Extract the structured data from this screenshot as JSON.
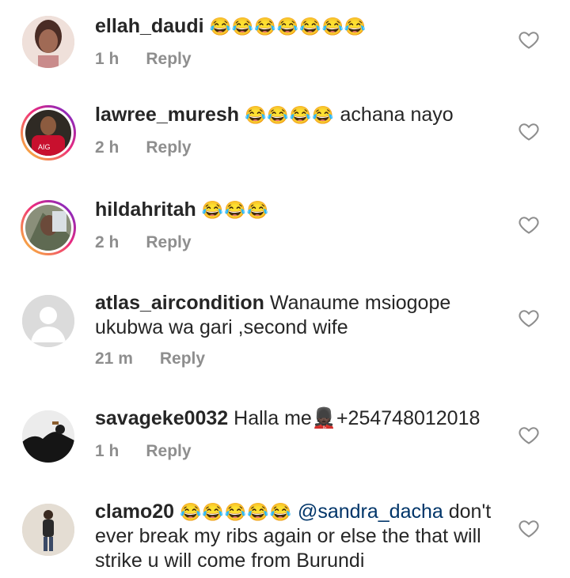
{
  "comments": [
    {
      "username": "ellah_daudi",
      "text": "",
      "emojis": "😂😂😂😂😂😂😂",
      "time": "1 h",
      "reply": "Reply",
      "avatar": "woman-portrait",
      "story_ring": false
    },
    {
      "username": "lawree_muresh",
      "text": "achana nayo",
      "emojis": "😂😂😂😂",
      "time": "2 h",
      "reply": "Reply",
      "avatar": "footballer-red-jersey",
      "avatar_caption": "AIG",
      "story_ring": true
    },
    {
      "username": "hildahritah",
      "text": "",
      "emojis": "😂😂😂",
      "time": "2 h",
      "reply": "Reply",
      "avatar": "selfie",
      "story_ring": true
    },
    {
      "username": "atlas_aircondition",
      "text": "Wanaume msiogope ukubwa wa gari ,second wife",
      "emojis": "",
      "time": "21 m",
      "reply": "Reply",
      "avatar": "default-avatar",
      "story_ring": false
    },
    {
      "username": "savageke0032",
      "text": "Halla me💂🏿+254748012018",
      "emojis": "",
      "time": "1 h",
      "reply": "Reply",
      "avatar": "silhouette",
      "story_ring": false
    },
    {
      "username": "clamo20",
      "text": "don't ever break my ribs again or else the that will strike u will come from Burundi",
      "emojis": "😂😂😂😂😂",
      "mention": "@sandra_dacha",
      "time": "",
      "reply": "",
      "avatar": "man-full-body",
      "story_ring": false
    }
  ],
  "icons": {
    "like": "heart-outline-icon"
  },
  "colors": {
    "text": "#262626",
    "meta": "#8e8e8e",
    "mention": "#003569"
  }
}
